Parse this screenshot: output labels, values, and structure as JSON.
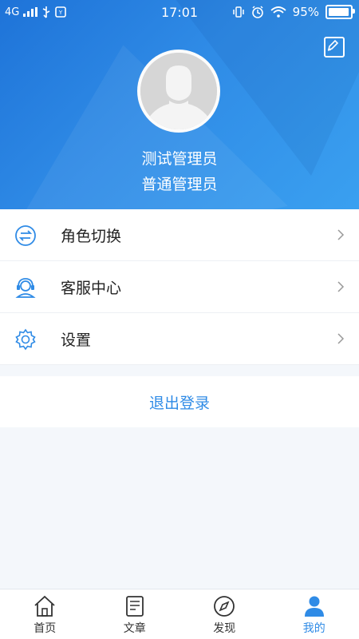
{
  "status_bar": {
    "network": "4G",
    "time": "17:01",
    "battery_percent": "95%"
  },
  "profile": {
    "name": "测试管理员",
    "role": "普通管理员"
  },
  "menu": {
    "items": [
      {
        "label": "角色切换",
        "icon": "swap-icon"
      },
      {
        "label": "客服中心",
        "icon": "headset-icon"
      },
      {
        "label": "设置",
        "icon": "gear-icon"
      }
    ]
  },
  "logout_label": "退出登录",
  "bottom_nav": {
    "tabs": [
      {
        "label": "首页",
        "icon": "home-icon"
      },
      {
        "label": "文章",
        "icon": "article-icon"
      },
      {
        "label": "发现",
        "icon": "compass-icon"
      },
      {
        "label": "我的",
        "icon": "user-icon",
        "active": true
      }
    ]
  },
  "colors": {
    "accent": "#2f8be6",
    "header_start": "#1e73d8",
    "header_end": "#3aa0f0"
  }
}
